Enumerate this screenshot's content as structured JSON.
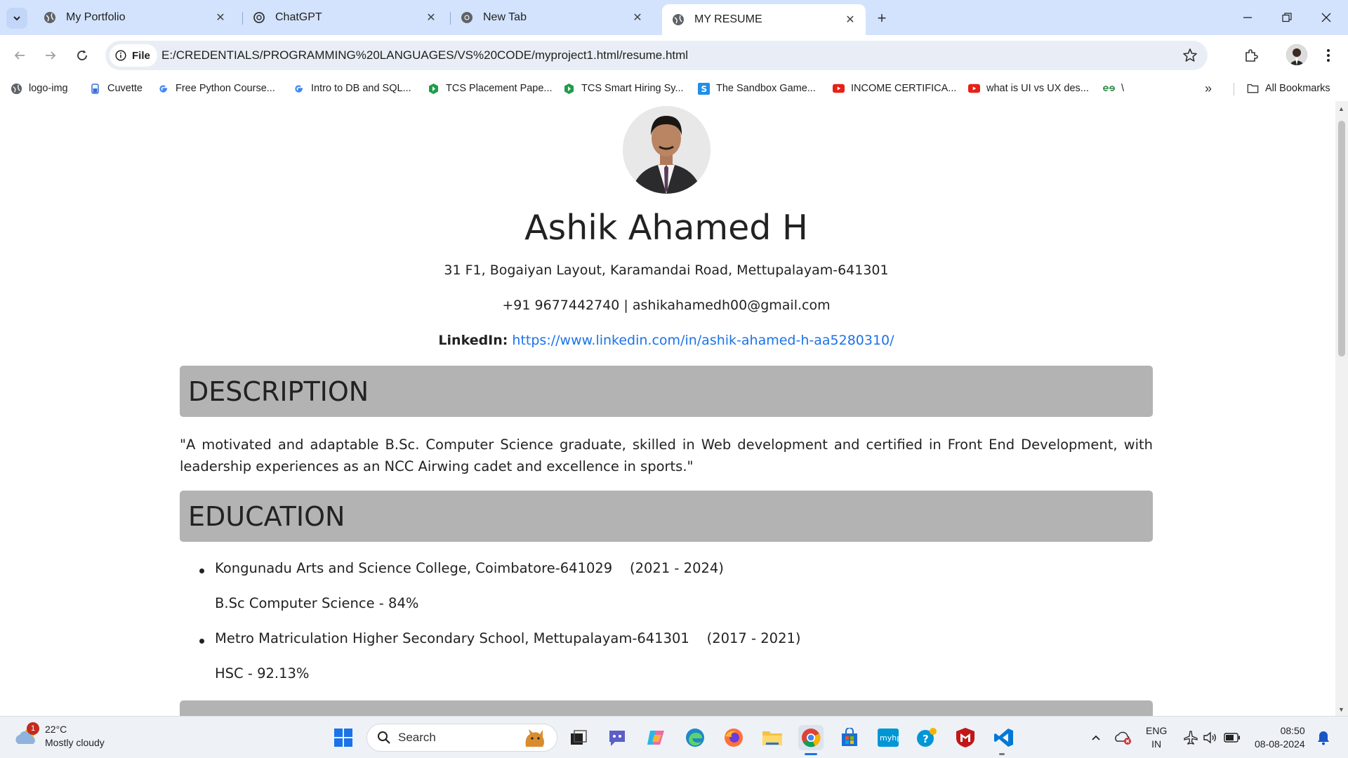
{
  "browser": {
    "tabs": [
      {
        "title": "My Portfolio",
        "active": false
      },
      {
        "title": "ChatGPT",
        "active": false
      },
      {
        "title": "New Tab",
        "active": false
      },
      {
        "title": "MY RESUME",
        "active": true
      }
    ],
    "new_tab": "+",
    "address": {
      "chip_label": "File",
      "url": "E:/CREDENTIALS/PROGRAMMING%20LANGUAGES/VS%20CODE/myproject1.html/resume.html"
    },
    "bookmarks": [
      {
        "label": "logo-img",
        "icon": "globe-icon"
      },
      {
        "label": "Cuvette",
        "icon": "cuvette-icon"
      },
      {
        "label": "Free Python Course...",
        "icon": "google-icon"
      },
      {
        "label": "Intro to DB and SQL...",
        "icon": "google-icon"
      },
      {
        "label": "TCS Placement Pape...",
        "icon": "green-shield-icon"
      },
      {
        "label": "TCS Smart Hiring Sy...",
        "icon": "green-shield-icon"
      },
      {
        "label": "The Sandbox Game...",
        "icon": "sandbox-icon"
      },
      {
        "label": "INCOME CERTIFICA...",
        "icon": "youtube-icon"
      },
      {
        "label": "what is UI vs UX des...",
        "icon": "youtube-icon"
      },
      {
        "label": "\\",
        "icon": "geeksforgeeks-icon"
      }
    ],
    "bookmarks_more": "»",
    "all_bookmarks": "All Bookmarks"
  },
  "resume": {
    "name": "Ashik Ahamed H",
    "address": "31 F1, Bogaiyan Layout, Karamandai Road, Mettupalayam-641301",
    "contact": "+91 9677442740 | ashikahamedh00@gmail.com",
    "linkedin_label": "LinkedIn:",
    "linkedin_url": "https://www.linkedin.com/in/ashik-ahamed-h-aa5280310/",
    "description_heading": "DESCRIPTION",
    "description": "\"A motivated and adaptable B.Sc. Computer Science graduate, skilled in Web development and certified in Front End Development, with leadership experiences as an NCC Airwing cadet and excellence in sports.\"",
    "education_heading": "EDUCATION",
    "education": [
      {
        "institution": "Kongunadu Arts and Science College, Coimbatore-641029",
        "years": "(2021 - 2024)",
        "detail": "B.Sc Computer Science - 84%"
      },
      {
        "institution": "Metro Matriculation Higher Secondary School, Mettupalayam-641301",
        "years": "(2017 - 2021)",
        "detail": "HSC - 92.13%"
      }
    ]
  },
  "taskbar": {
    "weather_badge": "1",
    "temperature": "22°C",
    "condition": "Mostly cloudy",
    "search_placeholder": "Search",
    "language_line1": "ENG",
    "language_line2": "IN",
    "time": "08:50",
    "date": "08-08-2024"
  }
}
